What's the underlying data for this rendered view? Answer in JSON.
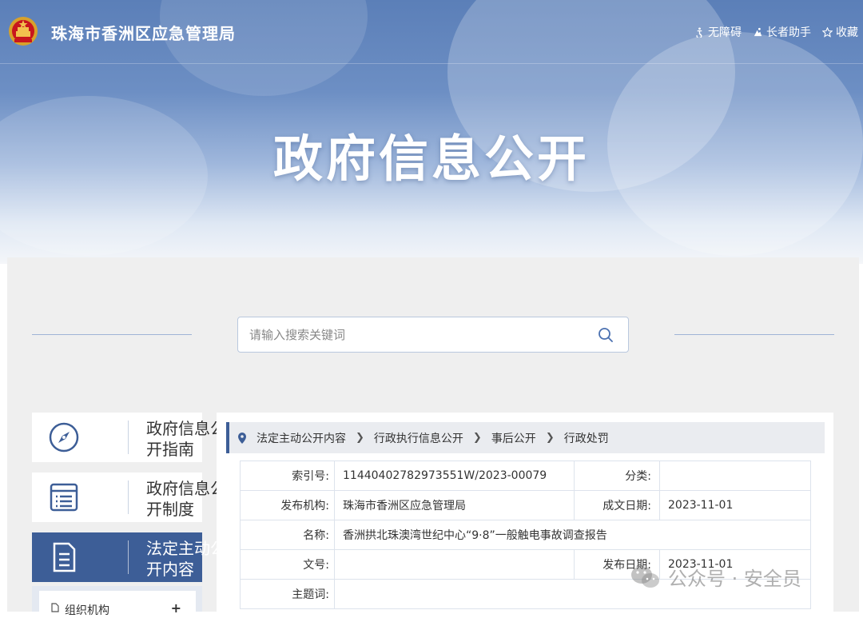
{
  "header": {
    "site_title": "珠海市香洲区应急管理局",
    "links": [
      {
        "label": "无障碍",
        "icon": "accessibility-icon"
      },
      {
        "label": "长者助手",
        "icon": "elder-assist-icon"
      },
      {
        "label": "收藏",
        "icon": "star-icon"
      }
    ],
    "hero_title": "政府信息公开"
  },
  "search": {
    "placeholder": "请输入搜索关键词"
  },
  "sidebar": {
    "items": [
      {
        "label": "政府信息公开指南",
        "icon": "compass-icon",
        "active": false
      },
      {
        "label": "政府信息公开制度",
        "icon": "list-icon",
        "active": false
      },
      {
        "label": "法定主动公开内容",
        "icon": "document-icon",
        "active": true
      }
    ],
    "sub_items": [
      {
        "label": "组织机构",
        "expand": "+"
      }
    ]
  },
  "breadcrumb": [
    "法定主动公开内容",
    "行政执行信息公开",
    "事后公开",
    "行政处罚"
  ],
  "meta": {
    "index_label": "索引号:",
    "index_value": "11440402782973551W/2023-00079",
    "category_label": "分类:",
    "category_value": "",
    "publisher_label": "发布机构:",
    "publisher_value": "珠海市香洲区应急管理局",
    "created_label": "成文日期:",
    "created_value": "2023-11-01",
    "name_label": "名称:",
    "name_value": "香洲拱北珠澳湾世纪中心“9·8”一般触电事故调查报告",
    "docno_label": "文号:",
    "docno_value": "",
    "published_label": "发布日期:",
    "published_value": "2023-11-01",
    "keywords_label": "主题词:",
    "keywords_value": ""
  },
  "watermark": {
    "text": "公众号 · 安全员"
  },
  "colors": {
    "accent": "#3d5e97",
    "banner_top": "#5b7fb8"
  }
}
